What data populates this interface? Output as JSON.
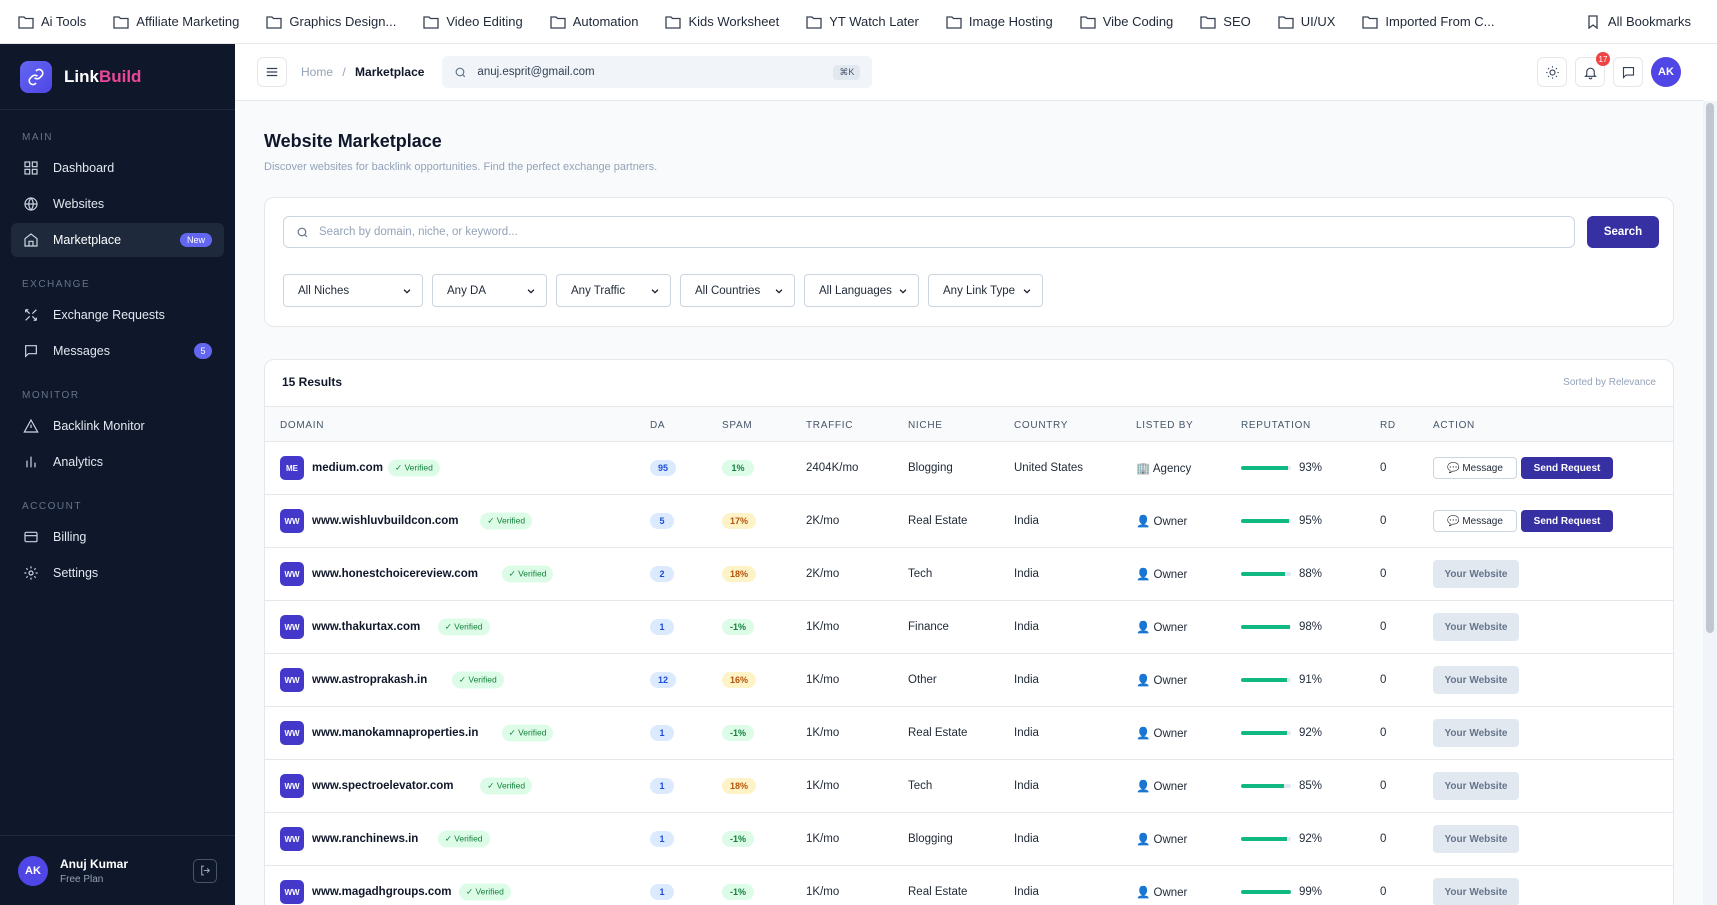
{
  "bookmarks": {
    "items": [
      "Ai Tools",
      "Affiliate Marketing",
      "Graphics Design...",
      "Video Editing",
      "Automation",
      "Kids Worksheet",
      "YT Watch Later",
      "Image Hosting",
      "Vibe Coding",
      "SEO",
      "UI/UX",
      "Imported From C..."
    ],
    "all": "All Bookmarks"
  },
  "sidebar": {
    "brand_a": "Link",
    "brand_b": "Build",
    "sections": {
      "main": "MAIN",
      "exchange": "EXCHANGE",
      "monitor": "MONITOR",
      "account": "ACCOUNT"
    },
    "dashboard": "Dashboard",
    "websites": "Websites",
    "marketplace": "Marketplace",
    "new_badge": "New",
    "exchange_requests": "Exchange Requests",
    "messages": "Messages",
    "messages_count": "5",
    "backlink_monitor": "Backlink Monitor",
    "analytics": "Analytics",
    "billing": "Billing",
    "settings": "Settings",
    "user": {
      "initials": "AK",
      "name": "Anuj Kumar",
      "plan": "Free Plan"
    }
  },
  "topbar": {
    "home": "Home",
    "sep": "/",
    "current": "Marketplace",
    "search_value": "anuj.esprit@gmail.com",
    "kbd": "⌘K",
    "notif_count": "17",
    "avatar": "AK"
  },
  "page": {
    "title": "Website Marketplace",
    "subtitle": "Discover websites for backlink opportunities. Find the perfect exchange partners.",
    "search_placeholder": "Search by domain, niche, or keyword...",
    "search_button": "Search",
    "filters": [
      "All Niches",
      "Any DA",
      "Any Traffic",
      "All Countries",
      "All Languages",
      "Any Link Type"
    ],
    "results": "15 Results",
    "sorted": "Sorted by Relevance",
    "columns": {
      "domain": "DOMAIN",
      "da": "DA",
      "spam": "SPAM",
      "traffic": "TRAFFIC",
      "niche": "NICHE",
      "country": "COUNTRY",
      "listed": "LISTED BY",
      "rep": "REPUTATION",
      "rd": "RD",
      "action": "ACTION"
    },
    "verified": "✓ Verified",
    "message_btn": "💬 Message",
    "request_btn": "Send Request",
    "your_btn": "Your Website"
  },
  "rows": [
    {
      "initials": "ME",
      "domain": "medium.com",
      "da": "95",
      "spam": "1%",
      "spam_level": "g",
      "traffic": "2404K/mo",
      "niche": "Blogging",
      "country": "United States",
      "listed": "🏢 Agency",
      "rep": "93%",
      "rep_value": 93,
      "rd": "0",
      "own": false
    },
    {
      "initials": "WW",
      "domain": "www.wishluvbuildcon.com",
      "da": "5",
      "spam": "17%",
      "spam_level": "y",
      "traffic": "2K/mo",
      "niche": "Real Estate",
      "country": "India",
      "listed": "👤 Owner",
      "rep": "95%",
      "rep_value": 95,
      "rd": "0",
      "own": false
    },
    {
      "initials": "WW",
      "domain": "www.honestchoicereview.com",
      "da": "2",
      "spam": "18%",
      "spam_level": "y",
      "traffic": "2K/mo",
      "niche": "Tech",
      "country": "India",
      "listed": "👤 Owner",
      "rep": "88%",
      "rep_value": 88,
      "rd": "0",
      "own": true
    },
    {
      "initials": "WW",
      "domain": "www.thakurtax.com",
      "da": "1",
      "spam": "-1%",
      "spam_level": "g",
      "traffic": "1K/mo",
      "niche": "Finance",
      "country": "India",
      "listed": "👤 Owner",
      "rep": "98%",
      "rep_value": 98,
      "rd": "0",
      "own": true
    },
    {
      "initials": "WW",
      "domain": "www.astroprakash.in",
      "da": "12",
      "spam": "16%",
      "spam_level": "y",
      "traffic": "1K/mo",
      "niche": "Other",
      "country": "India",
      "listed": "👤 Owner",
      "rep": "91%",
      "rep_value": 91,
      "rd": "0",
      "own": true
    },
    {
      "initials": "WW",
      "domain": "www.manokamnaproperties.in",
      "da": "1",
      "spam": "-1%",
      "spam_level": "g",
      "traffic": "1K/mo",
      "niche": "Real Estate",
      "country": "India",
      "listed": "👤 Owner",
      "rep": "92%",
      "rep_value": 92,
      "rd": "0",
      "own": true
    },
    {
      "initials": "WW",
      "domain": "www.spectroelevator.com",
      "da": "1",
      "spam": "18%",
      "spam_level": "y",
      "traffic": "1K/mo",
      "niche": "Tech",
      "country": "India",
      "listed": "👤 Owner",
      "rep": "85%",
      "rep_value": 85,
      "rd": "0",
      "own": true
    },
    {
      "initials": "WW",
      "domain": "www.ranchinews.in",
      "da": "1",
      "spam": "-1%",
      "spam_level": "g",
      "traffic": "1K/mo",
      "niche": "Blogging",
      "country": "India",
      "listed": "👤 Owner",
      "rep": "92%",
      "rep_value": 92,
      "rd": "0",
      "own": true
    },
    {
      "initials": "WW",
      "domain": "www.magadhgroups.com",
      "da": "1",
      "spam": "-1%",
      "spam_level": "g",
      "traffic": "1K/mo",
      "niche": "Real Estate",
      "country": "India",
      "listed": "👤 Owner",
      "rep": "99%",
      "rep_value": 99,
      "rd": "0",
      "own": true
    }
  ]
}
